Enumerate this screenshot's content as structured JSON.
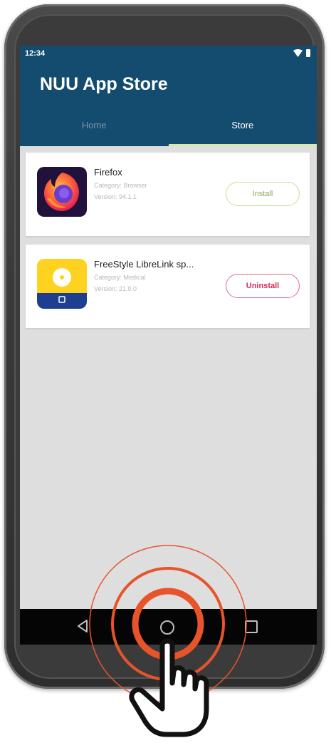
{
  "status_bar": {
    "time": "12:34"
  },
  "app": {
    "title": "NUU App Store"
  },
  "tabs": [
    {
      "label": "Home",
      "selected": false
    },
    {
      "label": "Store",
      "selected": true
    }
  ],
  "apps": [
    {
      "name": "Firefox",
      "category": "Category: Browser",
      "version": "Version: 94.1.1",
      "action": "Install",
      "icon": "firefox-icon"
    },
    {
      "name": "FreeStyle LibreLink sp...",
      "category": "Category: Medical",
      "version": "Version: 21.0.0",
      "action": "Uninstall",
      "icon": "librelink-icon"
    }
  ],
  "navigation": {
    "back": "back-icon",
    "home": "home-icon",
    "recents": "recents-icon"
  },
  "overlay": {
    "tap_indicator": "tap-ripple-icon",
    "hand": "pointing-hand-icon"
  },
  "colors": {
    "app_bar": "#134c6e",
    "tab_indicator": "#d7e9a6",
    "uninstall": "#d92a55",
    "install": "#8ea65a",
    "tap": "#e8542a"
  }
}
